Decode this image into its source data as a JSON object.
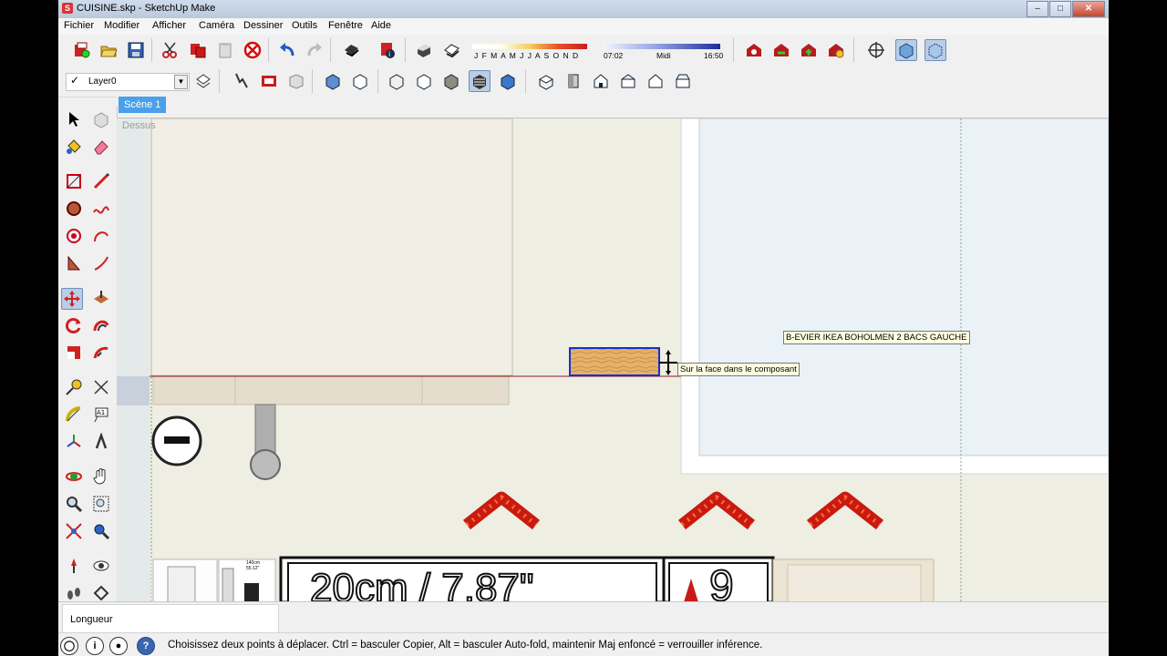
{
  "window": {
    "title": "CUISINE.skp - SketchUp Make"
  },
  "menu": [
    "Fichier",
    "Modifier",
    "Afficher",
    "Caméra",
    "Dessiner",
    "Outils",
    "Fenêtre",
    "Aide"
  ],
  "shadows": {
    "months": "J F M A M J J A S O N D",
    "time_start": "07:02",
    "time_mid": "Midi",
    "time_end": "16:50"
  },
  "layer": {
    "name": "Layer0"
  },
  "scene": {
    "tab": "Scène 1",
    "camera_label": "Dessus"
  },
  "viewport": {
    "component_label": "B-EVIER IKEA BOHOLMEN 2 BACS GAUCHE",
    "tooltip": "Sur la face dans le composant",
    "sign_text": "20cm / 7.87\"",
    "sign_digit": "9",
    "thumb_size": "140cm\n55.12\""
  },
  "status": {
    "measure_label": "Longueur",
    "message": "Choisissez deux points à déplacer.  Ctrl = basculer Copier, Alt = basculer Auto-fold, maintenir Maj enfoncé = verrouiller inférence."
  },
  "colors": {
    "accent": "#4aa0ea",
    "selection": "#1a2ec8",
    "arrow": "#e62a1a"
  }
}
